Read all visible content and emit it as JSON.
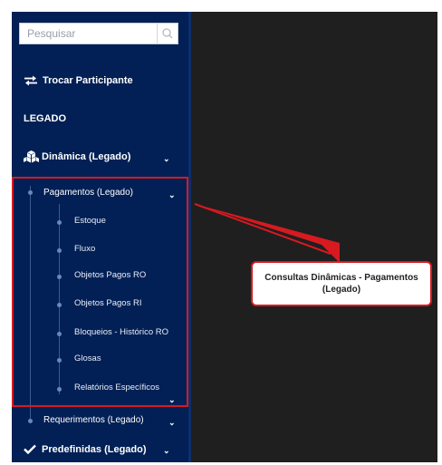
{
  "search": {
    "placeholder": "Pesquisar"
  },
  "menu": {
    "trocar_participante": "Trocar Participante",
    "legado_header": "LEGADO",
    "dinamica": "Dinâmica (Legado)",
    "pagamentos": "Pagamentos (Legado)",
    "pagamentos_items": [
      "Estoque",
      "Fluxo",
      "Objetos Pagos RO",
      "Objetos Pagos RI",
      "Bloqueios - Histórico RO",
      "Glosas",
      "Relatórios Específicos"
    ],
    "requerimentos": "Requerimentos (Legado)",
    "predefinidas": "Predefinidas (Legado)"
  },
  "callout": {
    "text": "Consultas Dinâmicas - Pagamentos (Legado)"
  },
  "icons": {
    "search": "search-icon",
    "swap": "swap-arrows-icon",
    "cubes": "cubes-icon",
    "check": "check-icon",
    "chevron": "chevron-down-icon"
  },
  "colors": {
    "sidebar": "#022055",
    "highlight": "#d71920",
    "background": "#1f1f1f"
  }
}
